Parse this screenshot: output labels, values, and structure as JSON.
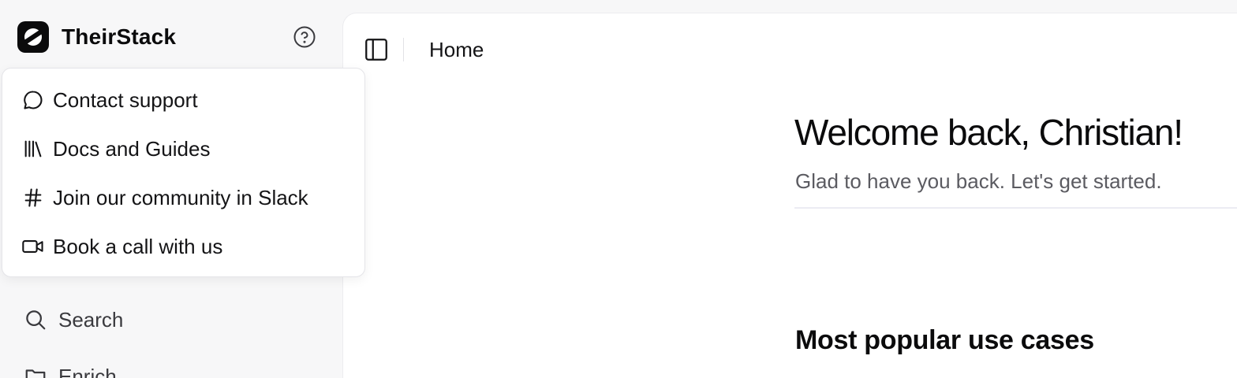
{
  "brand": {
    "name": "TheirStack"
  },
  "help_menu": {
    "items": [
      {
        "label": "Contact support",
        "icon": "message-circle-icon"
      },
      {
        "label": "Docs and Guides",
        "icon": "library-icon"
      },
      {
        "label": "Join our community in Slack",
        "icon": "hash-icon"
      },
      {
        "label": "Book a call with us",
        "icon": "video-icon"
      }
    ]
  },
  "sidebar": {
    "items": [
      {
        "label": "Search",
        "icon": "search-icon"
      },
      {
        "label": "Enrich",
        "icon": "folder-icon"
      }
    ]
  },
  "header": {
    "breadcrumb": "Home"
  },
  "main": {
    "welcome_title": "Welcome back, Christian!",
    "welcome_subtitle": "Glad to have you back. Let's get started.",
    "section_title": "Most popular use cases"
  }
}
